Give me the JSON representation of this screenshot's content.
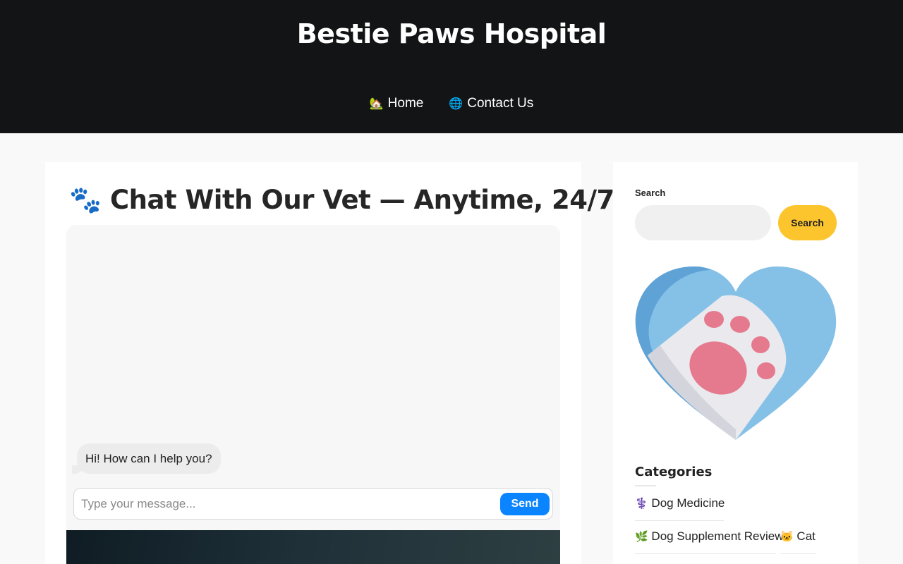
{
  "header": {
    "site_title": "Bestie Paws Hospital",
    "nav": [
      {
        "icon": "🏡",
        "label": "Home"
      },
      {
        "icon": "🌐",
        "label": "Contact Us"
      }
    ]
  },
  "main": {
    "paw_icon": "🐾",
    "title": "Chat With Our Vet — Anytime, 24/7",
    "chat": {
      "bot_message": "Hi! How can I help you?",
      "input_placeholder": "Type your message...",
      "send_label": "Send"
    }
  },
  "sidebar": {
    "search": {
      "label": "Search",
      "button_label": "Search",
      "value": ""
    },
    "categories": {
      "heading": "Categories",
      "items": [
        {
          "icon": "⚕️",
          "label": "Dog Medicine"
        },
        {
          "icon": "🌿",
          "label": "Dog Supplement Review"
        },
        {
          "icon": "🐱",
          "label": "Cat"
        }
      ]
    }
  },
  "colors": {
    "header_bg": "#131416",
    "send_button": "#0a84ff",
    "search_button": "#fdc52d",
    "heart_blue": "#85c1e6",
    "paw_pink": "#e57a8f"
  }
}
